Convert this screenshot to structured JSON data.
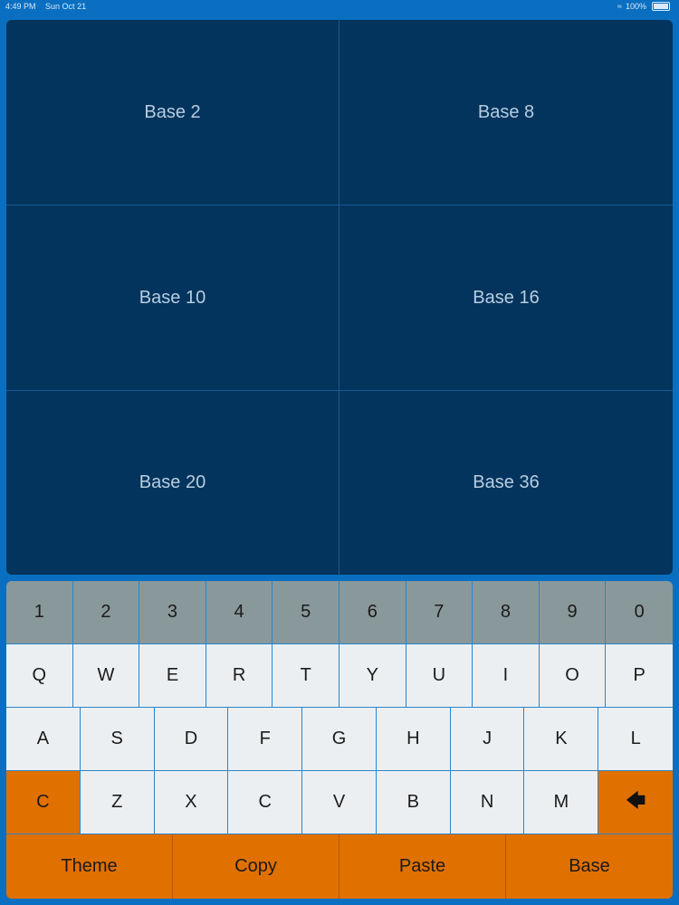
{
  "status_bar": {
    "time": "4:49 PM",
    "date": "Sun Oct 21",
    "battery": "100%",
    "icons": [
      "wifi-icon",
      "battery-icon"
    ]
  },
  "display": {
    "cells": [
      "Base 2",
      "Base 8",
      "Base 10",
      "Base 16",
      "Base 20",
      "Base 36"
    ]
  },
  "keyboard": {
    "number_row": [
      "1",
      "2",
      "3",
      "4",
      "5",
      "6",
      "7",
      "8",
      "9",
      "0"
    ],
    "row_q": [
      "Q",
      "W",
      "E",
      "R",
      "T",
      "Y",
      "U",
      "I",
      "O",
      "P"
    ],
    "row_a": [
      "A",
      "S",
      "D",
      "F",
      "G",
      "H",
      "J",
      "K",
      "L"
    ],
    "row_z": [
      "C",
      "Z",
      "X",
      "C",
      "V",
      "B",
      "N",
      "M"
    ],
    "backspace_icon": "backspace-arrow-icon",
    "bottom_row": [
      "Theme",
      "Copy",
      "Paste",
      "Base"
    ]
  },
  "colors": {
    "background": "#0a6fc0",
    "display_bg": "#03345d",
    "number_keys": "#89989a",
    "letter_keys": "#eceff1",
    "action_keys": "#e07000"
  }
}
